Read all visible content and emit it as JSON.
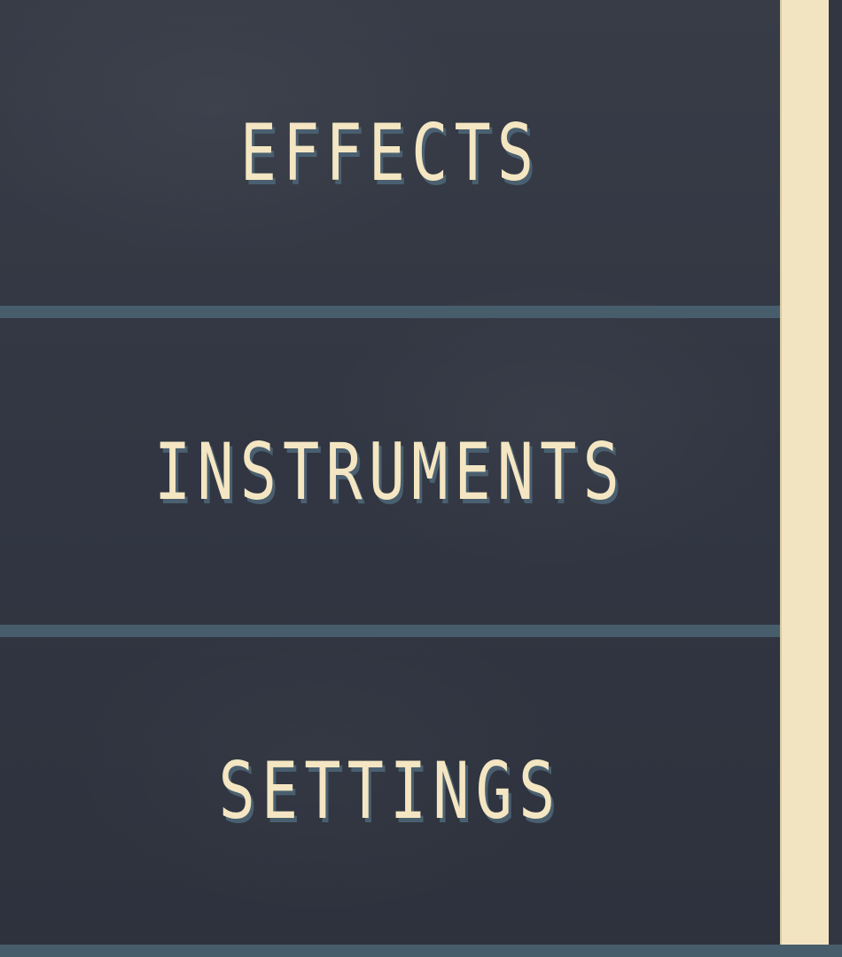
{
  "menu": {
    "items": [
      {
        "label": "EFFECTS"
      },
      {
        "label": "INSTRUMENTS"
      },
      {
        "label": "SETTINGS"
      }
    ]
  },
  "scrollbar": {
    "visible_fraction": 1.0
  },
  "colors": {
    "background": "#313642",
    "label": "#f4e6c2",
    "label_shadow": "#4a6070",
    "divider": "#485d6b",
    "scroll_thumb": "#f3e4c1"
  }
}
